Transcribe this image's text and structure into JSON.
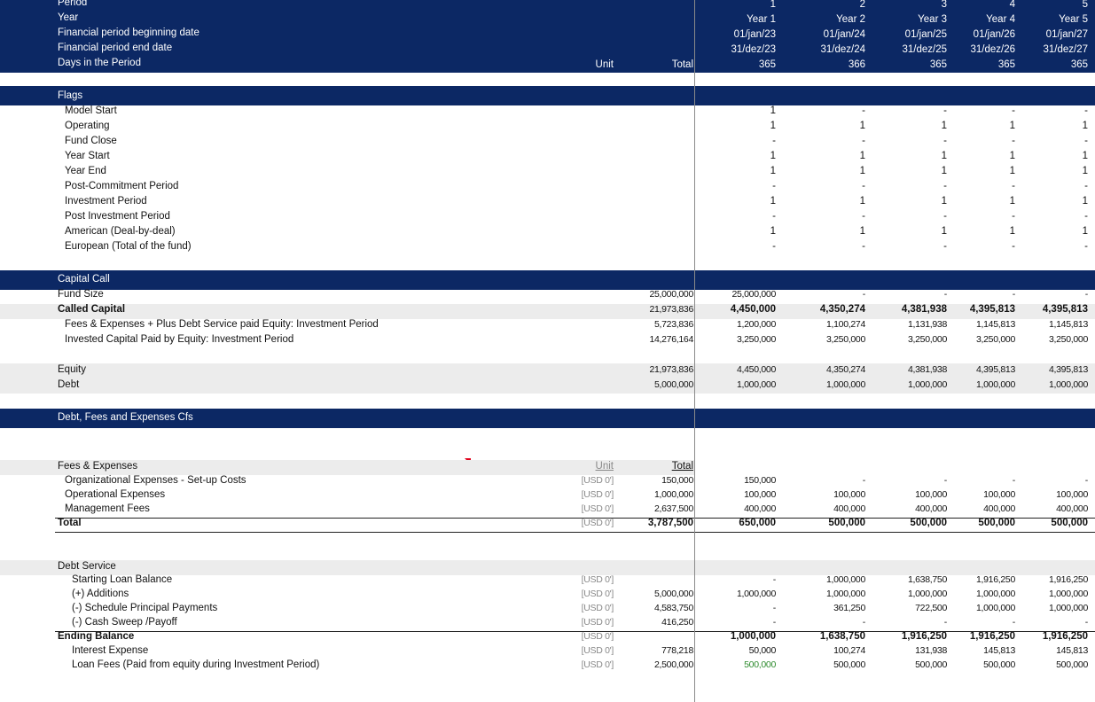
{
  "header": {
    "labels": [
      "Period",
      "Year",
      "Financial period beginning date",
      "Financial period end date",
      "Days in the Period"
    ],
    "unit_label": "Unit",
    "total_label": "Total",
    "periods": [
      {
        "period": "1",
        "year": "Year 1",
        "begin": "01/jan/23",
        "end": "31/dez/23",
        "days": "365"
      },
      {
        "period": "2",
        "year": "Year 2",
        "begin": "01/jan/24",
        "end": "31/dez/24",
        "days": "366"
      },
      {
        "period": "3",
        "year": "Year 3",
        "begin": "01/jan/25",
        "end": "31/dez/25",
        "days": "365"
      },
      {
        "period": "4",
        "year": "Year 4",
        "begin": "01/jan/26",
        "end": "31/dez/26",
        "days": "365"
      },
      {
        "period": "5",
        "year": "Year 5",
        "begin": "01/jan/27",
        "end": "31/dez/27",
        "days": "365"
      }
    ]
  },
  "flags": {
    "title": "Flags",
    "rows": [
      {
        "label": "Model Start",
        "values": [
          "1",
          "-",
          "-",
          "-",
          "-"
        ]
      },
      {
        "label": "Operating",
        "values": [
          "1",
          "1",
          "1",
          "1",
          "1"
        ]
      },
      {
        "label": "Fund Close",
        "values": [
          "-",
          "-",
          "-",
          "-",
          "-"
        ]
      },
      {
        "label": "Year Start",
        "values": [
          "1",
          "1",
          "1",
          "1",
          "1"
        ]
      },
      {
        "label": "Year End",
        "values": [
          "1",
          "1",
          "1",
          "1",
          "1"
        ]
      },
      {
        "label": "Post-Commitment Period",
        "values": [
          "-",
          "-",
          "-",
          "-",
          "-"
        ]
      },
      {
        "label": "Investment Period",
        "values": [
          "1",
          "1",
          "1",
          "1",
          "1"
        ]
      },
      {
        "label": "Post Investment Period",
        "values": [
          "-",
          "-",
          "-",
          "-",
          "-"
        ]
      },
      {
        "label": "American (Deal-by-deal)",
        "values": [
          "1",
          "1",
          "1",
          "1",
          "1"
        ]
      },
      {
        "label": "European (Total of the fund)",
        "values": [
          "-",
          "-",
          "-",
          "-",
          "-"
        ]
      }
    ]
  },
  "capital_call": {
    "title": "Capital  Call",
    "rows": [
      {
        "label": "Fund Size",
        "total": "25,000,000",
        "values": [
          "25,000,000",
          "-",
          "-",
          "-",
          "-"
        ]
      },
      {
        "label": "Called Capital",
        "total": "21,973,836",
        "values": [
          "4,450,000",
          "4,350,274",
          "4,381,938",
          "4,395,813",
          "4,395,813"
        ]
      },
      {
        "label": "Fees & Expenses + Plus Debt Service paid Equity: Investment Period",
        "total": "5,723,836",
        "values": [
          "1,200,000",
          "1,100,274",
          "1,131,938",
          "1,145,813",
          "1,145,813"
        ]
      },
      {
        "label": "Invested Capital Paid by Equity: Investment Period",
        "total": "14,276,164",
        "values": [
          "3,250,000",
          "3,250,000",
          "3,250,000",
          "3,250,000",
          "3,250,000"
        ]
      }
    ],
    "split": [
      {
        "label": "Equity",
        "total": "21,973,836",
        "values": [
          "4,450,000",
          "4,350,274",
          "4,381,938",
          "4,395,813",
          "4,395,813"
        ]
      },
      {
        "label": "Debt",
        "total": "5,000,000",
        "values": [
          "1,000,000",
          "1,000,000",
          "1,000,000",
          "1,000,000",
          "1,000,000"
        ]
      }
    ]
  },
  "debt_fees": {
    "title": "Debt, Fees and Expenses Cfs",
    "fees": {
      "title": "Fees & Expenses",
      "unit_label": "Unit",
      "total_label": "Total",
      "rows": [
        {
          "label": "Organizational Expenses - Set-up Costs",
          "unit": "[USD 0']",
          "total": "150,000",
          "values": [
            "150,000",
            "-",
            "-",
            "-",
            "-"
          ]
        },
        {
          "label": "Operational Expenses",
          "unit": "[USD 0']",
          "total": "1,000,000",
          "values": [
            "100,000",
            "100,000",
            "100,000",
            "100,000",
            "100,000"
          ]
        },
        {
          "label": "Management Fees",
          "unit": "[USD 0']",
          "total": "2,637,500",
          "values": [
            "400,000",
            "400,000",
            "400,000",
            "400,000",
            "400,000"
          ]
        }
      ],
      "total_row": {
        "label": "Total",
        "unit": "[USD 0']",
        "total": "3,787,500",
        "values": [
          "650,000",
          "500,000",
          "500,000",
          "500,000",
          "500,000"
        ]
      }
    },
    "debt": {
      "title": "Debt Service",
      "rows": [
        {
          "label": "Starting Loan Balance",
          "unit": "[USD 0']",
          "total": "",
          "values": [
            "-",
            "1,000,000",
            "1,638,750",
            "1,916,250",
            "1,916,250"
          ]
        },
        {
          "label": "(+) Additions",
          "unit": "[USD 0']",
          "total": "5,000,000",
          "values": [
            "1,000,000",
            "1,000,000",
            "1,000,000",
            "1,000,000",
            "1,000,000"
          ]
        },
        {
          "label": "(-) Schedule Principal Payments",
          "unit": "[USD 0']",
          "total": "4,583,750",
          "values": [
            "-",
            "361,250",
            "722,500",
            "1,000,000",
            "1,000,000"
          ]
        },
        {
          "label": "(-) Cash Sweep /Payoff",
          "unit": "[USD 0']",
          "total": "416,250",
          "values": [
            "-",
            "-",
            "-",
            "-",
            "-"
          ]
        }
      ],
      "ending": {
        "label": "Ending Balance",
        "unit": "[USD 0']",
        "total": "",
        "values": [
          "1,000,000",
          "1,638,750",
          "1,916,250",
          "1,916,250",
          "1,916,250"
        ]
      },
      "interest": {
        "label": "Interest Expense",
        "unit": "[USD 0']",
        "total": "778,218",
        "values": [
          "50,000",
          "100,274",
          "131,938",
          "145,813",
          "145,813"
        ]
      },
      "loan_fees": {
        "label": "Loan Fees (Paid from equity during Investment Period)",
        "unit": "[USD 0']",
        "total": "2,500,000",
        "values": [
          "500,000",
          "500,000",
          "500,000",
          "500,000",
          "500,000"
        ]
      }
    }
  },
  "colors": {
    "header_navy": "#0c2864",
    "band_gray": "#ececec",
    "highlight_green": "#2e8b2e",
    "marker_red": "#e0001a"
  }
}
